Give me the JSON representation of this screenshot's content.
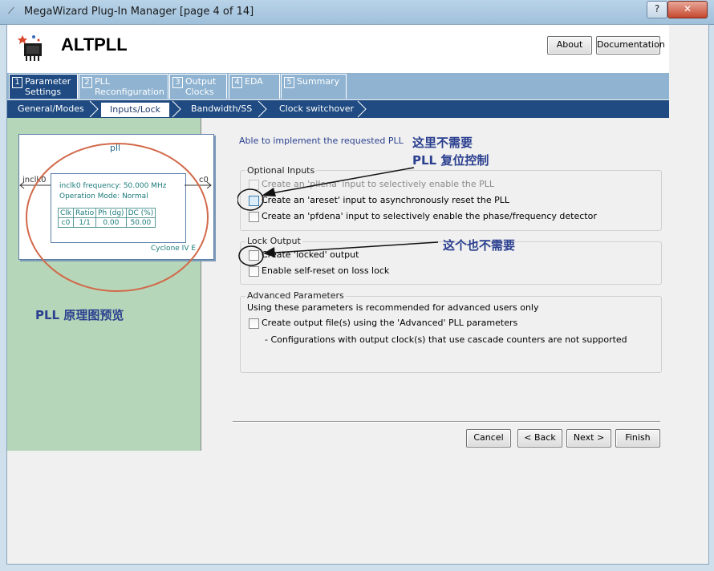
{
  "window": {
    "title": "MegaWizard Plug-In Manager [page 4 of 14]",
    "help_label": "?",
    "close_label": "✕",
    "app_icon": "wand-icon"
  },
  "header": {
    "name": "ALTPLL",
    "about_label": "About",
    "documentation_label": "Documentation"
  },
  "steps": [
    {
      "num": "1",
      "label": "Parameter\nSettings"
    },
    {
      "num": "2",
      "label": "PLL\nReconfiguration"
    },
    {
      "num": "3",
      "label": "Output\nClocks"
    },
    {
      "num": "4",
      "label": "EDA"
    },
    {
      "num": "5",
      "label": "Summary"
    }
  ],
  "subtabs": [
    "General/Modes",
    "Inputs/Lock",
    "Bandwidth/SS",
    "Clock switchover"
  ],
  "preview": {
    "name": "pll",
    "input_label": "inclk0",
    "output_label": "c0",
    "frequency": "inclk0 frequency: 50.000 MHz",
    "mode": "Operation Mode: Normal",
    "table_headers": [
      "Clk",
      "Ratio",
      "Ph (dg)",
      "DC (%)"
    ],
    "table_row": [
      "c0",
      "1/1",
      "0.00",
      "50.00"
    ],
    "device": "Cyclone IV E",
    "caption": "PLL 原理图预览"
  },
  "status_message": "Able to implement the requested PLL",
  "optional_inputs": {
    "title": "Optional Inputs",
    "items": [
      {
        "label": "Create an 'pllena' input to selectively enable the PLL",
        "checked": false,
        "disabled": true
      },
      {
        "label": "Create an 'areset' input to asynchronously reset the PLL",
        "checked": false,
        "disabled": false
      },
      {
        "label": "Create an 'pfdena' input to selectively enable the phase/frequency detector",
        "checked": false,
        "disabled": false
      }
    ]
  },
  "lock_output": {
    "title": "Lock Output",
    "items": [
      {
        "label": "Create 'locked' output",
        "checked": false
      },
      {
        "label": "Enable self-reset on loss lock",
        "checked": false
      }
    ]
  },
  "advanced": {
    "title": "Advanced Parameters",
    "note": "Using these parameters is recommended for advanced users only",
    "checkbox_label": "Create output file(s) using the 'Advanced' PLL parameters",
    "bullet": "- Configurations with output clock(s) that use cascade counters are not supported"
  },
  "annotations": {
    "reset_line1": "这里不需要",
    "reset_line2": "PLL 复位控制",
    "locked": "这个也不需要",
    "color": "#2a3f8f"
  },
  "footer": {
    "cancel": "Cancel",
    "back": "< Back",
    "next": "Next >",
    "finish": "Finish"
  }
}
